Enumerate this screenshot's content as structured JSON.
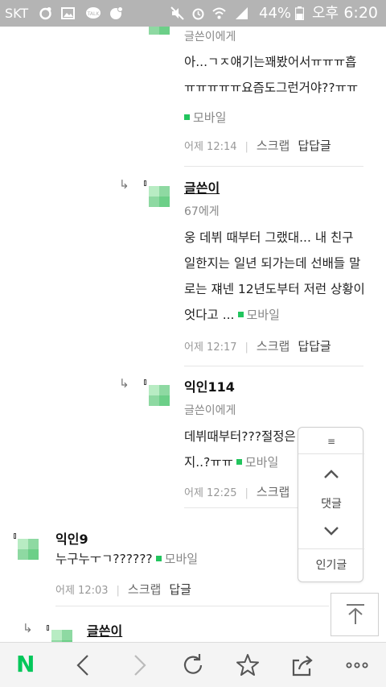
{
  "status_bar": {
    "carrier": "SKT",
    "battery": "44%",
    "ampm": "오후",
    "time": "6:20"
  },
  "comments": [
    {
      "target": "글쓴이에게",
      "body_lines": [
        "아...ㄱㅈ얘기는꽤봤어서ㅠㅠㅠ흡",
        "ㅠㅠㅠㅠㅠ요즘도그런거야??ㅠㅠ"
      ],
      "mobile": "모바일",
      "time": "어제 12:14",
      "scrap": "스크랩",
      "reply": "답답글"
    },
    {
      "author": "글쓴이",
      "target": "67에게",
      "body_lines": [
        "웅 데뷔 때부터 그랬대... 내 친구",
        "일한지는 일년 되가는데 선배들 말",
        "로는 쟤넨 12년도부터 저런 상황이",
        "엇다고 ..."
      ],
      "mobile": "모바일",
      "time": "어제 12:17",
      "scrap": "스크랩",
      "reply": "답답글"
    },
    {
      "author": "익인114",
      "target": "글쓴이에게",
      "body_lines": [
        "데뷔때부터???절정은",
        "지..?ㅠㅠ"
      ],
      "mobile": "모바일",
      "time": "어제 12:25",
      "scrap": "스크랩"
    },
    {
      "author": "익인9",
      "body_lines": [
        "누구누ㅜㄱ??????"
      ],
      "mobile": "모바일",
      "time": "어제 12:03",
      "scrap": "스크랩",
      "reply": "답글"
    },
    {
      "author": "글쓴이"
    }
  ],
  "float_nav": {
    "comments_label": "댓글",
    "popular_label": "인기글"
  },
  "bottom_bar": {
    "home_logo": "N"
  },
  "colors": {
    "status_bar": "#b4b4b4",
    "mobile_dot": "#22c55e",
    "naver_green": "#03c75a"
  }
}
